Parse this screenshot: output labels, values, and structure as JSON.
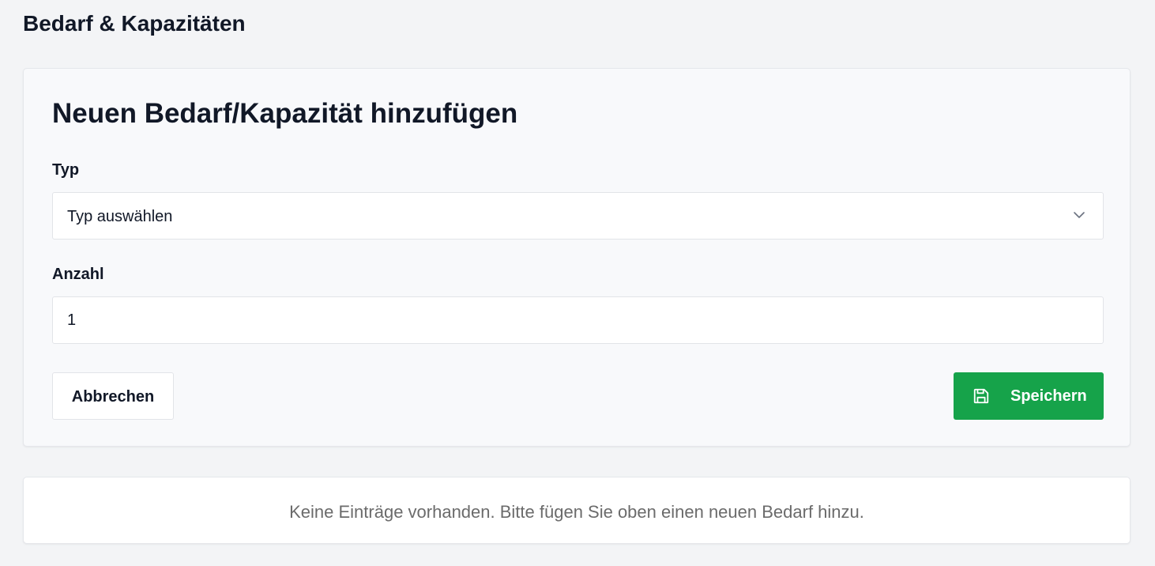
{
  "page": {
    "title": "Bedarf & Kapazitäten"
  },
  "form": {
    "heading": "Neuen Bedarf/Kapazität hinzufügen",
    "type_field": {
      "label": "Typ",
      "selected_value": "Typ auswählen",
      "icon": "chevron-down-icon"
    },
    "count_field": {
      "label": "Anzahl",
      "value": "1"
    },
    "cancel_label": "Abbrechen",
    "save_label": "Speichern",
    "save_icon": "save-icon"
  },
  "empty_state": {
    "message": "Keine Einträge vorhanden. Bitte fügen Sie oben einen neuen Bedarf hinzu."
  },
  "colors": {
    "background": "#f3f4f6",
    "card": "#f8f9fb",
    "primary": "#16a34a",
    "muted_text": "#6b6b6b"
  }
}
